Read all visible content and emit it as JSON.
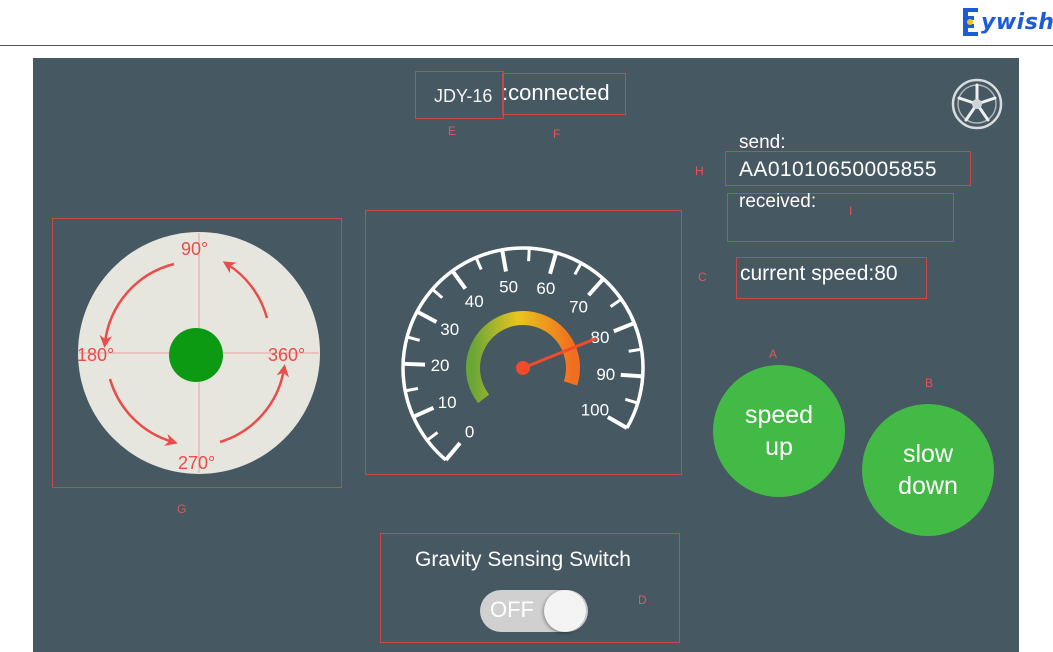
{
  "header": {
    "logo_text": "ywish",
    "brand_color": "#1e5bd9"
  },
  "device": {
    "name": "JDY-16",
    "status": ":connected"
  },
  "markers": {
    "a": "A",
    "b": "B",
    "c": "C",
    "d": "D",
    "e": "E",
    "f": "F",
    "g": "G",
    "h": "H",
    "i": "I"
  },
  "comm": {
    "send_label": "send:",
    "send_value": "AA01010650005855",
    "received_label": "received:",
    "received_value": ""
  },
  "speed": {
    "current_label": "current speed:80",
    "value": 80,
    "min": 0,
    "max": 100,
    "tick_labels": [
      "0",
      "10",
      "20",
      "30",
      "40",
      "50",
      "60",
      "70",
      "80",
      "90",
      "100"
    ]
  },
  "buttons": {
    "speed_up": [
      "speed",
      "up"
    ],
    "slow_down": [
      "slow",
      "down"
    ],
    "accent": "#44ba46"
  },
  "direction": {
    "labels": {
      "top": "90°",
      "left": "180°",
      "right": "360°",
      "bottom": "270°"
    },
    "pad_color": "#e6e5de",
    "knob_color": "#0b9a12",
    "arrow_color": "#e94d4a"
  },
  "gravity": {
    "title": "Gravity Sensing Switch",
    "toggle_label": "OFF",
    "toggle_state": "off"
  },
  "icons": {
    "settings": "wheel-icon"
  }
}
